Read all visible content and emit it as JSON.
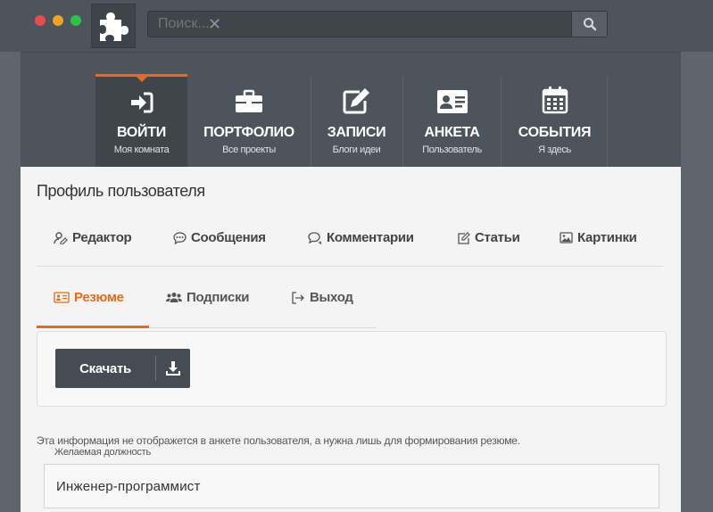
{
  "search": {
    "placeholder": "Поиск...",
    "clear_glyph": "✕"
  },
  "nav": {
    "items": [
      {
        "label": "ВОЙТИ",
        "sub": "Моя комната",
        "icon": "sign-in-icon",
        "active": true
      },
      {
        "label": "ПОРТФОЛИО",
        "sub": "Все проекты",
        "icon": "briefcase-icon"
      },
      {
        "label": "ЗАПИСИ",
        "sub": "Блоги идеи",
        "icon": "edit-icon"
      },
      {
        "label": "АНКЕТА",
        "sub": "Пользователь",
        "icon": "id-card-icon"
      },
      {
        "label": "СОБЫТИЯ",
        "sub": "Я здесь",
        "icon": "calendar-icon"
      }
    ]
  },
  "page": {
    "title": "Профиль пользователя"
  },
  "tabs1": [
    {
      "label": "Редактор",
      "icon": "user-edit-icon"
    },
    {
      "label": "Сообщения",
      "icon": "chat-icon"
    },
    {
      "label": "Комментарии",
      "icon": "comments-icon"
    },
    {
      "label": "Статьи",
      "icon": "pencil-square-icon"
    },
    {
      "label": "Картинки",
      "icon": "image-icon"
    }
  ],
  "tabs2": [
    {
      "label": "Резюме",
      "icon": "id-card-icon",
      "active": true
    },
    {
      "label": "Подписки",
      "icon": "users-icon"
    },
    {
      "label": "Выход",
      "icon": "sign-out-icon"
    }
  ],
  "download": {
    "label": "Скачать",
    "icon": "download-icon"
  },
  "info_text": "Эта информация не отображется в анкете пользователя, а нужна лишь для формирования резюме.",
  "position_field": {
    "label": "Желаемая должность",
    "value": "Инженер-программист"
  },
  "colors": {
    "accent": "#e86a1c",
    "header": "#4d545b"
  }
}
